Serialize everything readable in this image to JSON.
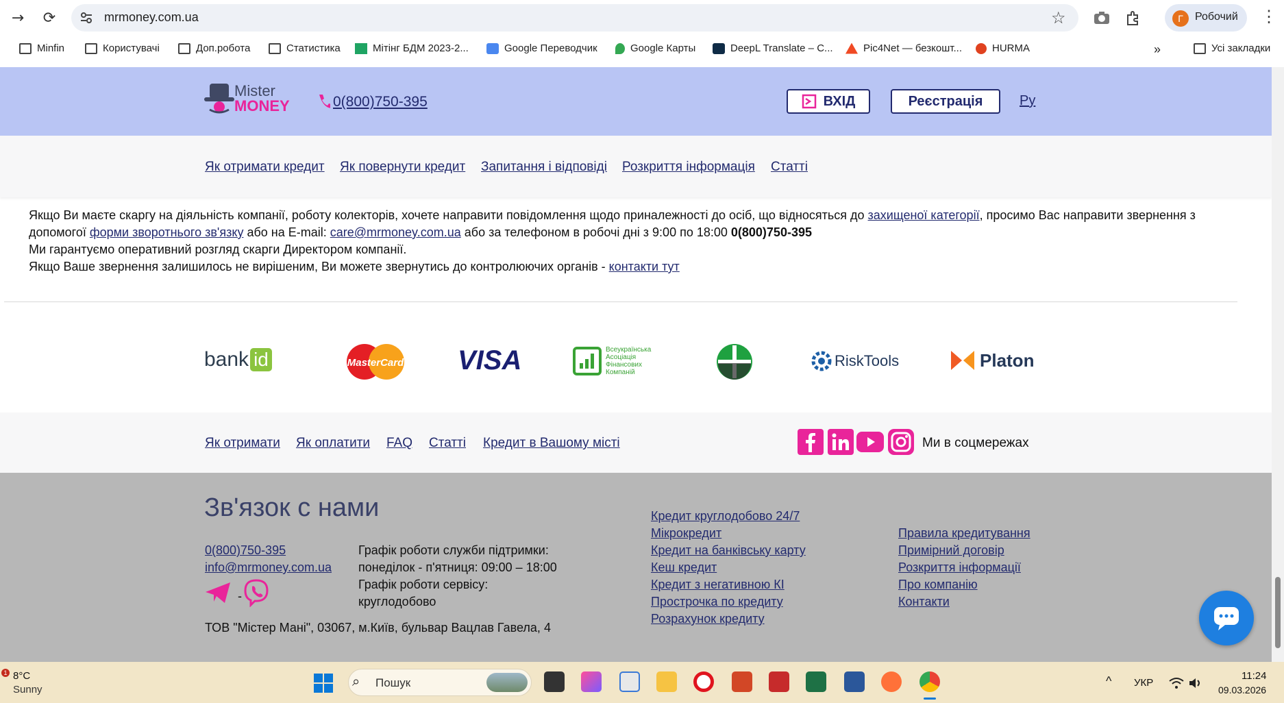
{
  "browser": {
    "url": "mrmoney.com.ua",
    "profile_initial": "Г",
    "profile_name": "Робочий",
    "bookmarks": [
      "Minfin",
      "Користувачі",
      "Доп.робота",
      "Статистика",
      "Мітінг БДМ 2023-2...",
      "Google Переводчик",
      "Google Карты",
      "DeepL Translate – С...",
      "Pic4Net — безкошт...",
      "HURMA"
    ],
    "all_bookmarks": "Усі закладки"
  },
  "header": {
    "logo_line1": "Mister",
    "logo_line2": "MONEY",
    "phone": "0(800)750-395",
    "login": "ВХІД",
    "register": "Реєстрація",
    "lang": "Ру"
  },
  "nav": [
    "Як отримати кредит",
    "Як повернути кредит",
    "Запитання і відповіді",
    "Розкриття інформація",
    "Статті"
  ],
  "notice": {
    "p1_a": "Якщо Ви маєте скаргу на діяльність компанії, роботу колекторів, хочете направити повідомлення щодо приналежності до осіб, що відносяться до ",
    "p1_link": "захищеної категорії",
    "p1_b": ", просимо Вас направити звернення з допомогої ",
    "p1_link2": "форми зворотнього зв'язку",
    "p1_c": " або на E-mail: ",
    "p1_email": "care@mrmoney.com.ua",
    "p1_d": " або за телефоном в робочі дні з 9:00 по 18:00 ",
    "p1_phone": "0(800)750-395",
    "p2": "Ми гарантуємо оперативний розгляд скарги Директором компанії.",
    "p3_a": "Якщо Ваше звернення залишилось не вирішеним, Ви можете звернутись до контролюючих органів - ",
    "p3_link": "контакти тут"
  },
  "partners": {
    "bankid": "bank",
    "bankid_box": "id",
    "mastercard": "MasterCard",
    "visa": "VISA",
    "vaafk": [
      "Всеукраїнська",
      "Асоціація",
      "Фінансових",
      "Компаній"
    ],
    "risktools": "RiskTools",
    "platon": "Platon"
  },
  "footer_links": [
    "Як отримати",
    "Як оплатити",
    "FAQ",
    "Статті",
    "Кредит в Вашому місті"
  ],
  "social_label": "Ми в соцмережах",
  "contact": {
    "title": "Зв'язок с нами",
    "phone": "0(800)750-395",
    "email": "info@mrmoney.com.ua",
    "separator": "-",
    "schedule1": "Графік роботи служби підтримки:",
    "schedule2": "понеділок - п'ятниця: 09:00 – 18:00",
    "schedule3": "Графік роботи сервісу:",
    "schedule4": "круглодобово",
    "address": "ТОВ \"Містер Мані\", 03067, м.Київ, бульвар Вацлав Гавела, 4",
    "col2": [
      "Кредит круглодобово 24/7",
      "Мікрокредит",
      "Кредит на банківську карту",
      "Кеш кредит",
      "Кредит з негативною КІ",
      "Прострочка по кредиту",
      "Розрахунок кредиту"
    ],
    "col3": [
      "Правила кредитування",
      "Примірний договір",
      "Розкриття інформації",
      "Про компанію",
      "Контакти"
    ]
  },
  "taskbar": {
    "weather_badge": "1",
    "temp": "8°C",
    "weather": "Sunny",
    "search": "Пошук",
    "lang": "УКР",
    "time": "11:24",
    "date": "09.03.2026"
  },
  "colors": {
    "header_bg": "#b9c5f4",
    "accent_pink": "#e9249a",
    "link_navy": "#222a6e",
    "footer_gray": "#b7b7b7",
    "chat_blue": "#1e7fe0"
  }
}
